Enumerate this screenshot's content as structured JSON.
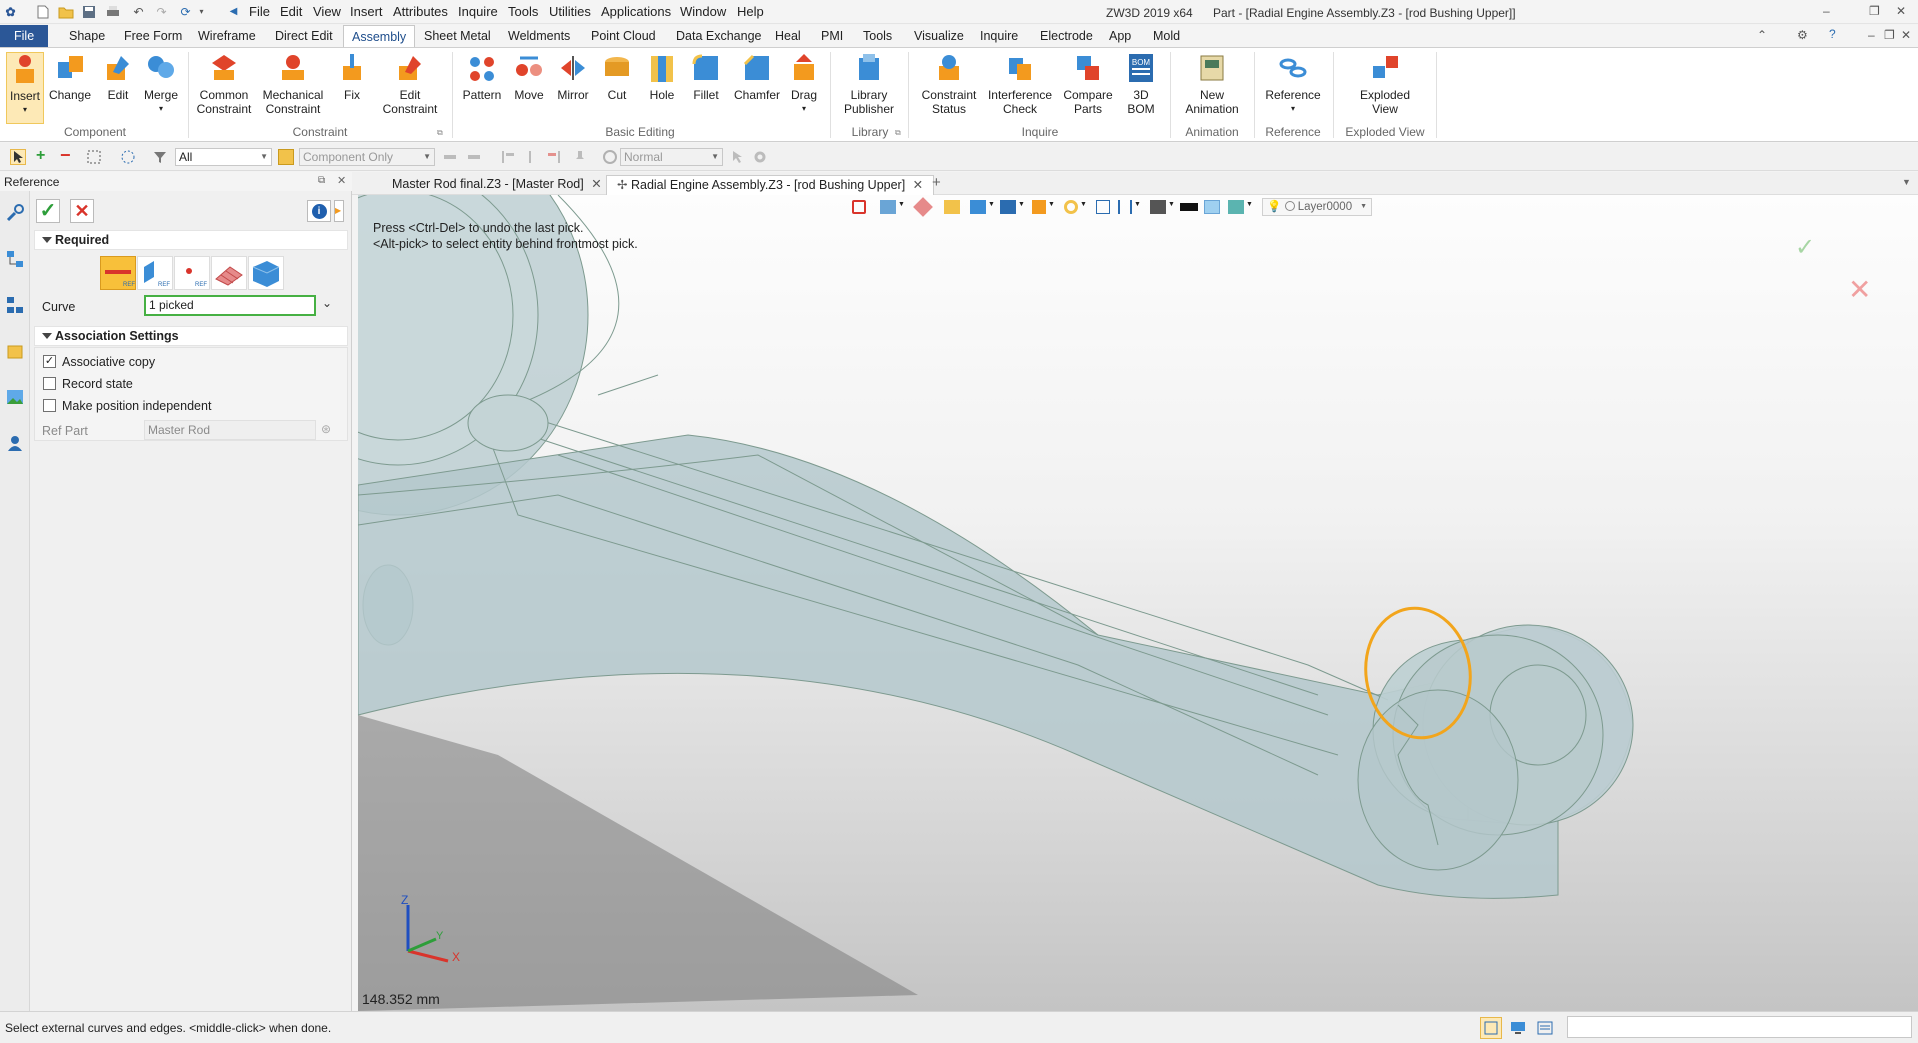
{
  "titlebar": {
    "menus": [
      "File",
      "Edit",
      "View",
      "Insert",
      "Attributes",
      "Inquire",
      "Tools",
      "Utilities",
      "Applications",
      "Window",
      "Help"
    ],
    "app_name": "ZW3D 2019  x64",
    "doc_title": "Part - [Radial Engine Assembly.Z3 - [rod Bushing Upper]]"
  },
  "ribbon_tabs": [
    "File",
    "Shape",
    "Free Form",
    "Wireframe",
    "Direct Edit",
    "Assembly",
    "Sheet Metal",
    "Weldments",
    "Point Cloud",
    "Data Exchange",
    "Heal",
    "PMI",
    "Tools",
    "Visualize",
    "Inquire",
    "Electrode",
    "App",
    "Mold"
  ],
  "ribbon": {
    "buttons": [
      "Insert",
      "Change",
      "Edit",
      "Merge",
      "Common\nConstraint",
      "Mechanical\nConstraint",
      "Fix",
      "Edit\nConstraint",
      "Pattern",
      "Move",
      "Mirror",
      "Cut",
      "Hole",
      "Fillet",
      "Chamfer",
      "Drag",
      "Library\nPublisher",
      "Constraint\nStatus",
      "Interference\nCheck",
      "Compare\nParts",
      "3D\nBOM",
      "New\nAnimation",
      "Reference",
      "Exploded\nView"
    ],
    "groups": [
      "Component",
      "Constraint",
      "Basic Editing",
      "Library",
      "Inquire",
      "Animation",
      "Reference",
      "Exploded View"
    ],
    "bom_icon_text": "BOM"
  },
  "toolbar2": {
    "filter_value": "All",
    "component_only": "Component Only",
    "render_mode": "Normal"
  },
  "panel": {
    "title": "Reference",
    "required": "Required",
    "curve_label": "Curve",
    "curve_value": "1 picked",
    "association": "Association Settings",
    "options": [
      "Associative copy",
      "Record state",
      "Make position independent"
    ],
    "ref_part_label": "Ref Part",
    "ref_part_value": "Master Rod",
    "info_icon_text": "i"
  },
  "doc_tabs": [
    "Master Rod final.Z3 - [Master Rod]",
    "Radial Engine Assembly.Z3 - [rod Bushing Upper]"
  ],
  "view": {
    "layer": "Layer0000",
    "hint1": "Press <Ctrl-Del> to undo the last pick.",
    "hint2": "<Alt-pick> to select entity behind frontmost pick.",
    "measure": "148.352 mm",
    "axis_z": "Z",
    "axis_y": "Y",
    "axis_x": "X"
  },
  "status": {
    "message": "Select external curves and edges.  <middle-click> when done."
  },
  "colors": {
    "file_tab": "#2b5797",
    "selection": "#f2a51c",
    "model_fill": "#b9ccd0",
    "model_edge": "#7d9a8f"
  }
}
